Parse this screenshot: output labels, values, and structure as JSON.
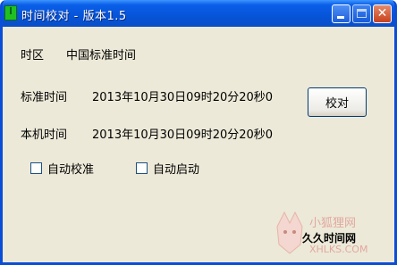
{
  "window": {
    "title": "时间校对 - 版本1.5"
  },
  "timezone": {
    "label": "时区",
    "value": "中国标准时间"
  },
  "standard_time": {
    "label": "标准时间",
    "value": "2013年10月30日09时20分20秒0"
  },
  "local_time": {
    "label": "本机时间",
    "value": "2013年10月30日09时20分20秒0"
  },
  "buttons": {
    "sync": "校对"
  },
  "options": {
    "auto_sync": {
      "label": "自动校准",
      "checked": false
    },
    "auto_start": {
      "label": "自动启动",
      "checked": false
    }
  },
  "watermark": {
    "site_cn": "小狐狸网",
    "site_en": "XHLKS.COM",
    "overlay": "久久时间网"
  }
}
